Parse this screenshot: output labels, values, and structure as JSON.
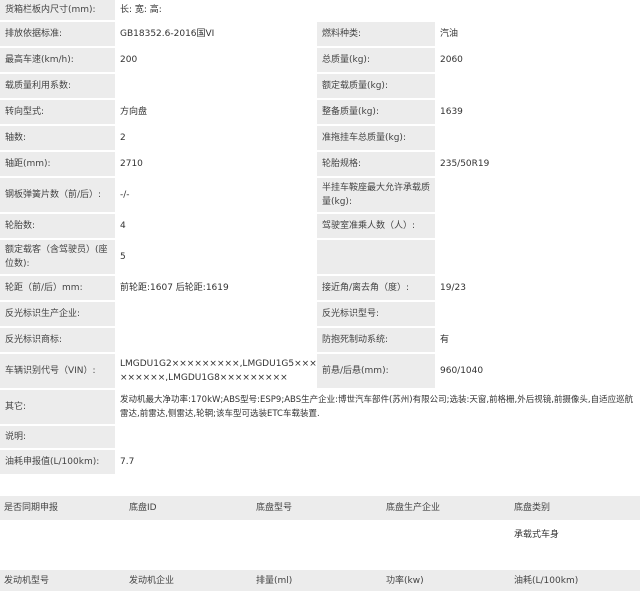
{
  "rows": [
    {
      "l1": "货箱栏板内尺寸(mm):",
      "v1": "长:  宽:  高:",
      "l2": "",
      "v2": ""
    },
    {
      "l1": "排放依据标准:",
      "v1": "GB18352.6-2016国VI",
      "l2": "燃料种类:",
      "v2": "汽油"
    },
    {
      "l1": "最高车速(km/h):",
      "v1": "200",
      "l2": "总质量(kg):",
      "v2": "2060"
    },
    {
      "l1": "载质量利用系数:",
      "v1": "",
      "l2": "额定载质量(kg):",
      "v2": ""
    },
    {
      "l1": "转向型式:",
      "v1": "方向盘",
      "l2": "整备质量(kg):",
      "v2": "1639"
    },
    {
      "l1": "轴数:",
      "v1": "2",
      "l2": "准拖挂车总质量(kg):",
      "v2": ""
    },
    {
      "l1": "轴距(mm):",
      "v1": "2710",
      "l2": "轮胎规格:",
      "v2": "235/50R19"
    },
    {
      "l1": "钢板弹簧片数（前/后）:",
      "v1": "-/-",
      "l2": "半挂车鞍座最大允许承载质量(kg):",
      "v2": ""
    },
    {
      "l1": "轮胎数:",
      "v1": "4",
      "l2": "驾驶室准乘人数（人）:",
      "v2": ""
    },
    {
      "l1": "额定载客（含驾驶员）(座位数):",
      "v1": "5",
      "l2": "",
      "v2": ""
    },
    {
      "l1": "轮距（前/后）mm:",
      "v1": "前轮距:1607 后轮距:1619",
      "l2": "接近角/离去角（度）:",
      "v2": "19/23"
    },
    {
      "l1": "反光标识生产企业:",
      "v1": "",
      "l2": "反光标识型号:",
      "v2": ""
    },
    {
      "l1": "反光标识商标:",
      "v1": "",
      "l2": "防抱死制动系统:",
      "v2": "有"
    },
    {
      "l1": "车辆识别代号（VIN）:",
      "v1": "LMGDU1G2×××××××××,LMGDU1G5×××××××××,LMGDU1G8×××××××××",
      "l2": "前悬/后悬(mm):",
      "v2": "960/1040"
    }
  ],
  "other": {
    "label": "其它:",
    "value": "发动机最大净功率:170kW;ABS型号:ESP9;ABS生产企业:博世汽车部件(苏州)有限公司;选装:天窗,前格栅,外后视镜,前摄像头,自适应巡航雷达,前雷达,侧雷达,轮辋;该车型可选装ETC车载装置."
  },
  "note": {
    "label": "说明:",
    "value": ""
  },
  "fuel": {
    "label": "油耗申报值(L/100km):",
    "value": "7.7"
  },
  "chassis": {
    "headers": [
      "是否同期申报",
      "底盘ID",
      "底盘型号",
      "底盘生产企业",
      "底盘类别"
    ],
    "values": [
      "",
      "",
      "",
      "",
      "承载式车身"
    ]
  },
  "engine": {
    "headers": [
      "发动机型号",
      "发动机企业",
      "排量(ml)",
      "功率(kw)",
      "油耗(L/100km)"
    ]
  }
}
